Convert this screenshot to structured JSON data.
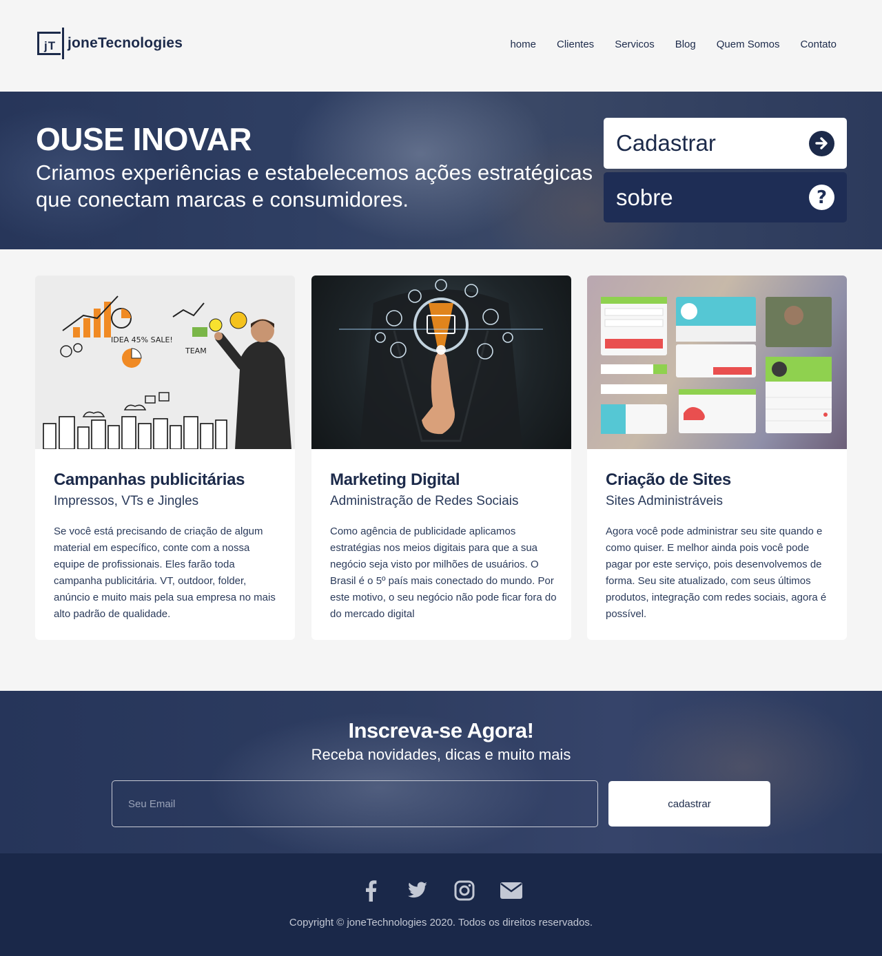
{
  "brand": {
    "logo_mark": "jT",
    "name": "joneTecnologies"
  },
  "nav": {
    "items": [
      {
        "label": "home"
      },
      {
        "label": "Clientes"
      },
      {
        "label": "Servicos"
      },
      {
        "label": "Blog"
      },
      {
        "label": "Quem Somos"
      },
      {
        "label": "Contato"
      }
    ]
  },
  "hero": {
    "title": "OUSE INOVAR",
    "subtitle": "Criamos experiências e estabelecemos ações estratégicas que conectam marcas e consumidores.",
    "cadastrar_label": "Cadastrar",
    "cadastrar_icon": "arrow-right-circle-icon",
    "sobre_label": "sobre",
    "sobre_icon": "question-circle-icon"
  },
  "cards": [
    {
      "title": "Campanhas publicitárias",
      "subtitle": "Impressos, VTs e Jingles",
      "text": "Se você está precisando de criação de algum material em específico, conte com a nossa equipe de profissionais. Eles farão toda campanha publicitária. VT, outdoor, folder, anúncio e muito mais pela sua empresa no mais alto padrão de qualidade.",
      "image": "businessman-drawing-marketing-sketches"
    },
    {
      "title": "Marketing Digital",
      "subtitle": "Administração de Redes Sociais",
      "text": "Como agência de publicidade aplicamos estratégias nos meios digitais para que a sua negócio seja visto por milhões de usuários. O Brasil é o 5º país mais conectado do mundo. Por este motivo, o seu negócio não pode ficar fora do do mercado digital",
      "image": "hand-touching-digital-icons"
    },
    {
      "title": "Criação de Sites",
      "subtitle": "Sites Administráveis",
      "text": "Agora você pode administrar seu site quando e como quiser. E melhor ainda pois você pode pagar por este serviço, pois desenvolvemos de forma. Seu site atualizado, com seus últimos produtos, integração com redes sociais, agora é possível.",
      "image": "ui-kit-widgets-collage"
    }
  ],
  "subscribe": {
    "title": "Inscreva-se Agora!",
    "subtitle": "Receba novidades, dicas e muito mais",
    "email_placeholder": "Seu Email",
    "email_value": "",
    "button_label": "cadastrar"
  },
  "footer": {
    "social_icons": [
      "facebook-icon",
      "twitter-icon",
      "instagram-icon",
      "email-icon"
    ],
    "copyright": "Copyright © joneTechnologies 2020. Todos os direitos reservados."
  },
  "colors": {
    "navy": "#1c2a4a",
    "footer_bg": "#1a2849",
    "page_bg": "#f5f5f5",
    "white": "#ffffff"
  }
}
